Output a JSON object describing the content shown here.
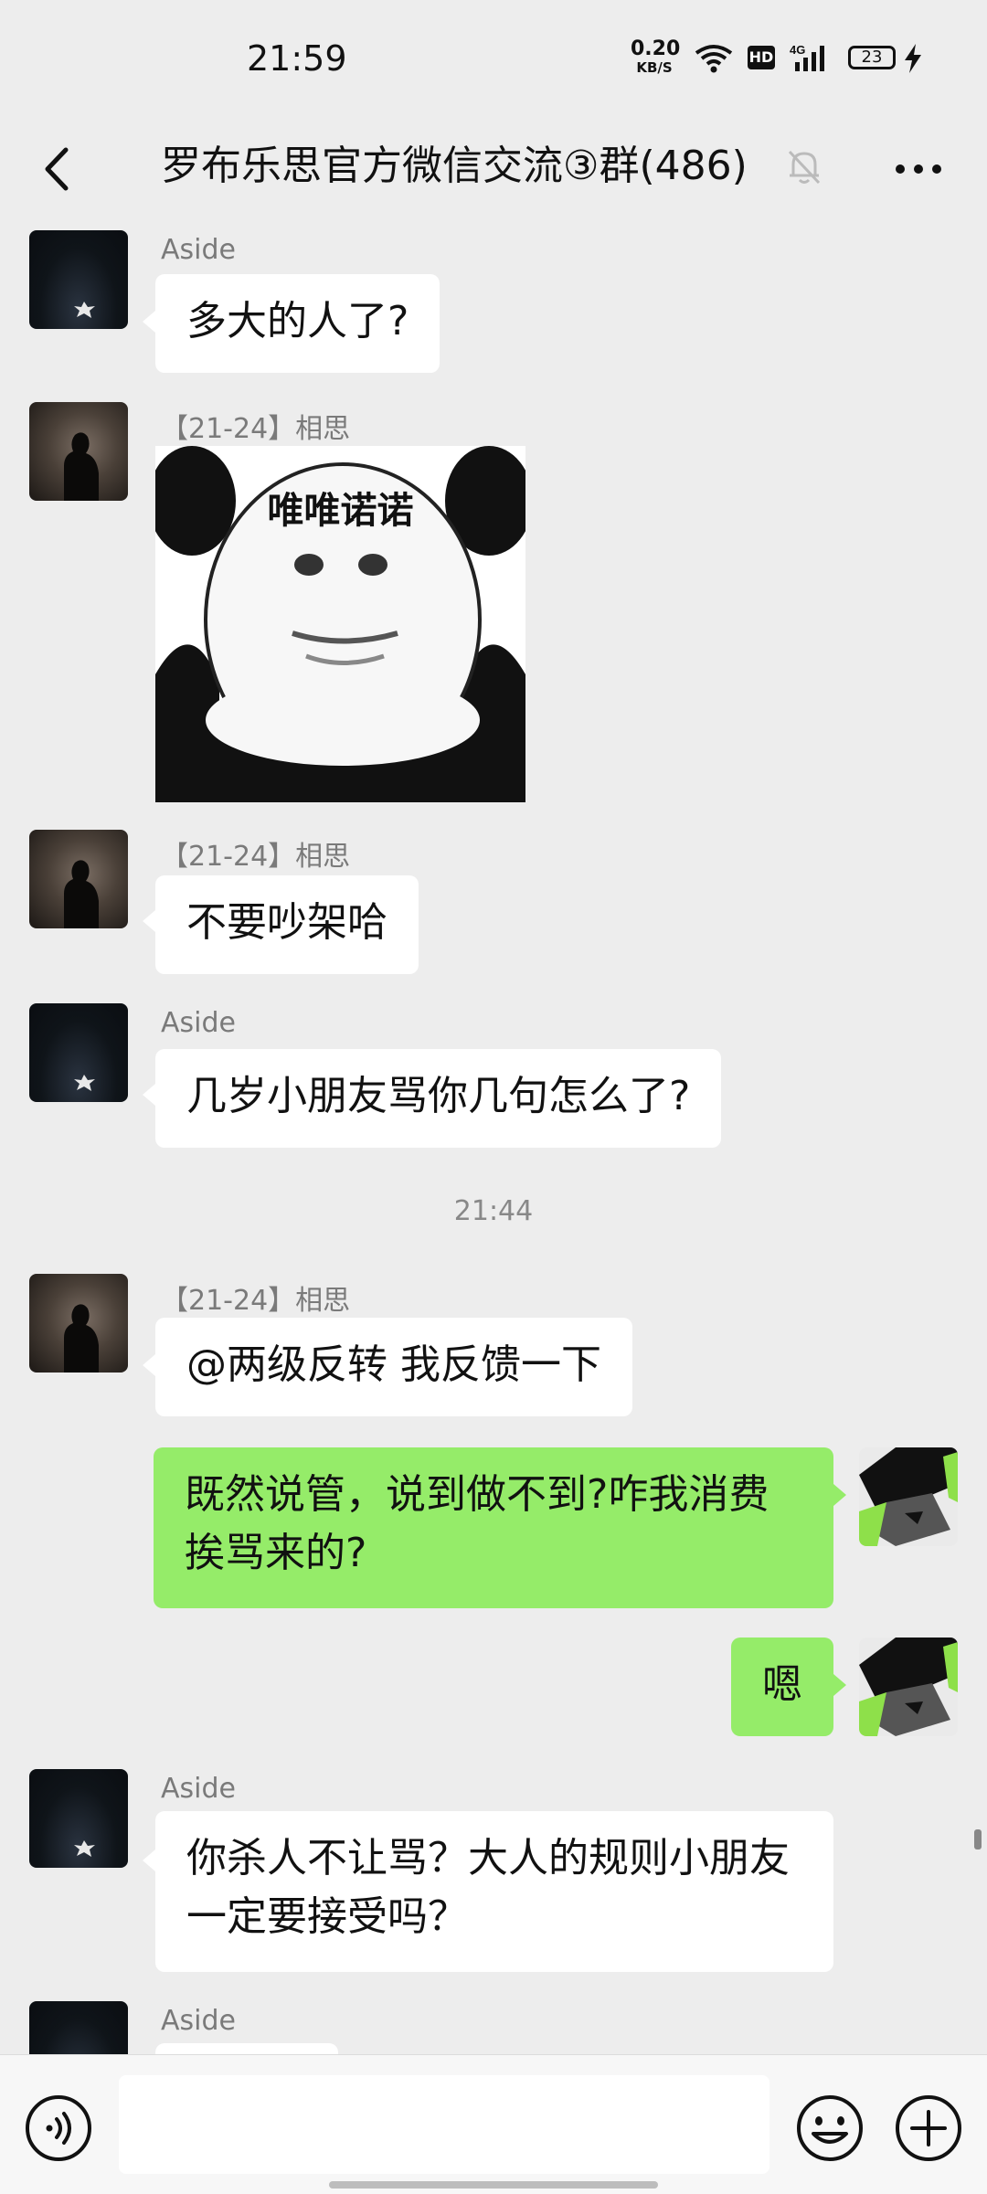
{
  "status_bar": {
    "time": "21:59",
    "net_speed_value": "0.20",
    "net_speed_unit": "KB/S",
    "hd_label": "HD",
    "signal_label": "4G",
    "battery": "23"
  },
  "header": {
    "title": "罗布乐思官方微信交流③群(486)"
  },
  "messages": [
    {
      "sender": "Aside",
      "text": "多大的人了?"
    },
    {
      "sender": "【21-24】相思",
      "sticker_text": "唯唯诺诺"
    },
    {
      "sender": "【21-24】相思",
      "text": "不要吵架哈"
    },
    {
      "sender": "Aside",
      "text": "几岁小朋友骂你几句怎么了?"
    },
    {
      "timestamp": "21:44"
    },
    {
      "sender": "【21-24】相思",
      "text": "@两级反转  我反馈一下"
    },
    {
      "sender": "me",
      "text": "既然说管，说到做不到?咋我消费挨骂来的?"
    },
    {
      "sender": "me",
      "text": "嗯"
    },
    {
      "sender": "Aside",
      "text": "你杀人不让骂？大人的规则小朋友一定要接受吗？"
    },
    {
      "sender": "Aside",
      "text": ""
    }
  ],
  "colors": {
    "background": "#ededed",
    "self_bubble": "#95ec69",
    "other_bubble": "#ffffff"
  },
  "icons": [
    "back-arrow-icon",
    "mute-bell-icon",
    "more-icon",
    "voice-icon",
    "emoji-icon",
    "plus-icon"
  ]
}
